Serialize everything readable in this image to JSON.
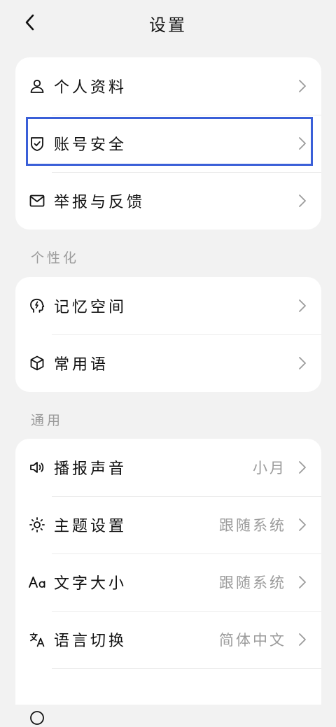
{
  "header": {
    "title": "设置"
  },
  "account_group": {
    "items": [
      {
        "label": "个人资料",
        "icon": "person-icon"
      },
      {
        "label": "账号安全",
        "icon": "shield-check-icon"
      },
      {
        "label": "举报与反馈",
        "icon": "mail-icon"
      }
    ]
  },
  "personalization": {
    "title": "个性化",
    "items": [
      {
        "label": "记忆空间",
        "icon": "memory-head-icon"
      },
      {
        "label": "常用语",
        "icon": "cube-icon"
      }
    ]
  },
  "general": {
    "title": "通用",
    "items": [
      {
        "label": "播报声音",
        "value": "小月",
        "icon": "speaker-icon"
      },
      {
        "label": "主题设置",
        "value": "跟随系统",
        "icon": "sun-icon"
      },
      {
        "label": "文字大小",
        "value": "跟随系统",
        "icon": "font-size-icon"
      },
      {
        "label": "语言切换",
        "value": "简体中文",
        "icon": "translate-icon"
      }
    ]
  },
  "colors": {
    "background": "#f2f2f2",
    "card": "#ffffff",
    "highlight": "#3a5fd8",
    "secondary_text": "#9b9b9b"
  }
}
